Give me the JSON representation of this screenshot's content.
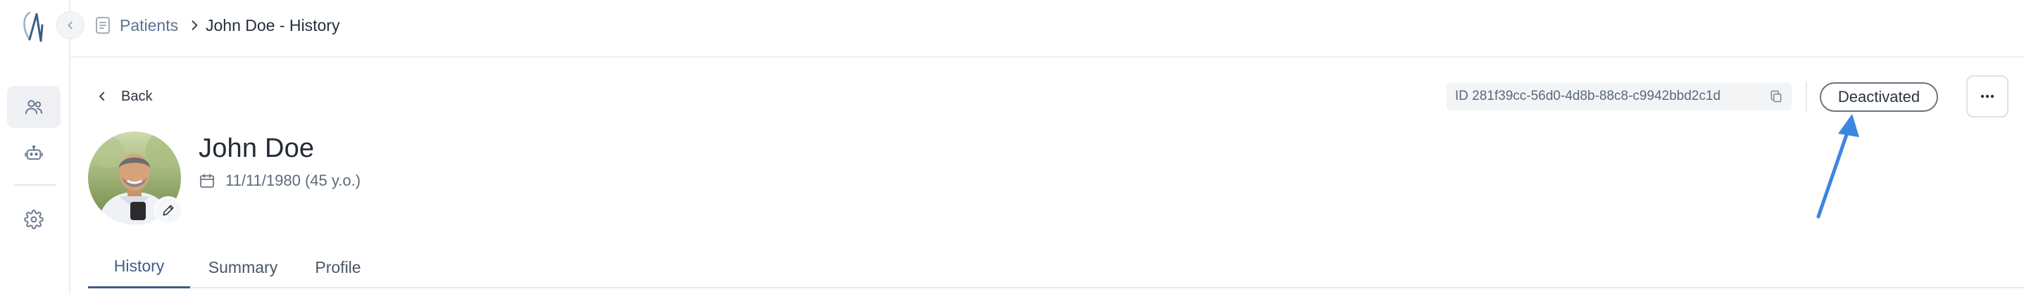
{
  "breadcrumb": {
    "parent": "Patients",
    "current": "John Doe - History"
  },
  "back": {
    "label": "Back"
  },
  "patient": {
    "id_text": "ID 281f39cc-56d0-4d8b-88c8-c9942bbd2c1d",
    "status": "Deactivated",
    "name": "John Doe",
    "dob": "11/11/1980 (45 y.o.)"
  },
  "tabs": [
    {
      "label": "History",
      "active": true
    },
    {
      "label": "Summary",
      "active": false
    },
    {
      "label": "Profile",
      "active": false
    }
  ],
  "colors": {
    "accent": "#3f5c86",
    "annotation_arrow": "#3b86e0"
  },
  "icons": {
    "logo": "brand-logo",
    "collapse": "chevron-left-icon",
    "crumb_doc": "document-icon",
    "crumb_sep": "chevron-right-icon",
    "nav_patients": "users-icon",
    "nav_bot": "robot-icon",
    "nav_settings": "gear-icon",
    "back": "chevron-left-icon",
    "copy": "copy-icon",
    "more": "more-horizontal-icon",
    "edit": "pencil-icon",
    "calendar": "calendar-icon"
  }
}
